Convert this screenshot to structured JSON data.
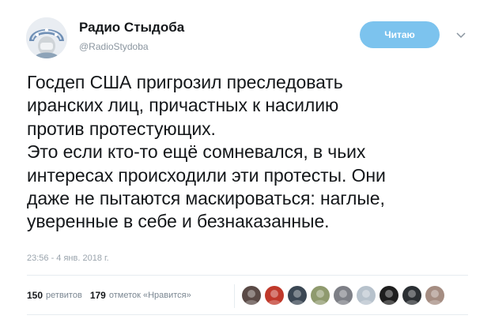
{
  "author": {
    "display_name": "Радио Стыдоба",
    "handle": "@RadioStydoba",
    "avatar_icon": "kokoshnik-avatar-icon"
  },
  "follow_button": {
    "label": "Читаю",
    "color": "#7cc3ee"
  },
  "more_icon": "chevron-down-icon",
  "tweet": {
    "lines": [
      "Госдеп США пригрозил преследовать",
      "иранских лиц, причастных к насилию",
      "против протестующих.",
      "Это если кто-то ещё сомневался, в чьих",
      "интересах происходили эти протесты. Они",
      "даже не пытаются маскироваться: наглые,",
      "уверенные в себе и безнаказанные."
    ]
  },
  "timestamp": "23:56 - 4 янв. 2018 г.",
  "stats": {
    "retweets_count": "150",
    "retweets_label": "ретвитов",
    "likes_count": "179",
    "likes_label": "отметок «Нравится»"
  },
  "likers": [
    {
      "name": "liker-avatar-1",
      "color": "#5a4a46"
    },
    {
      "name": "liker-avatar-2",
      "color": "#c0392b"
    },
    {
      "name": "liker-avatar-3",
      "color": "#3b4754"
    },
    {
      "name": "liker-avatar-4",
      "color": "#8f9a6e"
    },
    {
      "name": "liker-avatar-5",
      "color": "#7d7f86"
    },
    {
      "name": "liker-avatar-6",
      "color": "#b7c2cc"
    },
    {
      "name": "liker-avatar-7",
      "color": "#1e1e1e"
    },
    {
      "name": "liker-avatar-8",
      "color": "#2b2f33"
    },
    {
      "name": "liker-avatar-9",
      "color": "#a58d82"
    }
  ]
}
